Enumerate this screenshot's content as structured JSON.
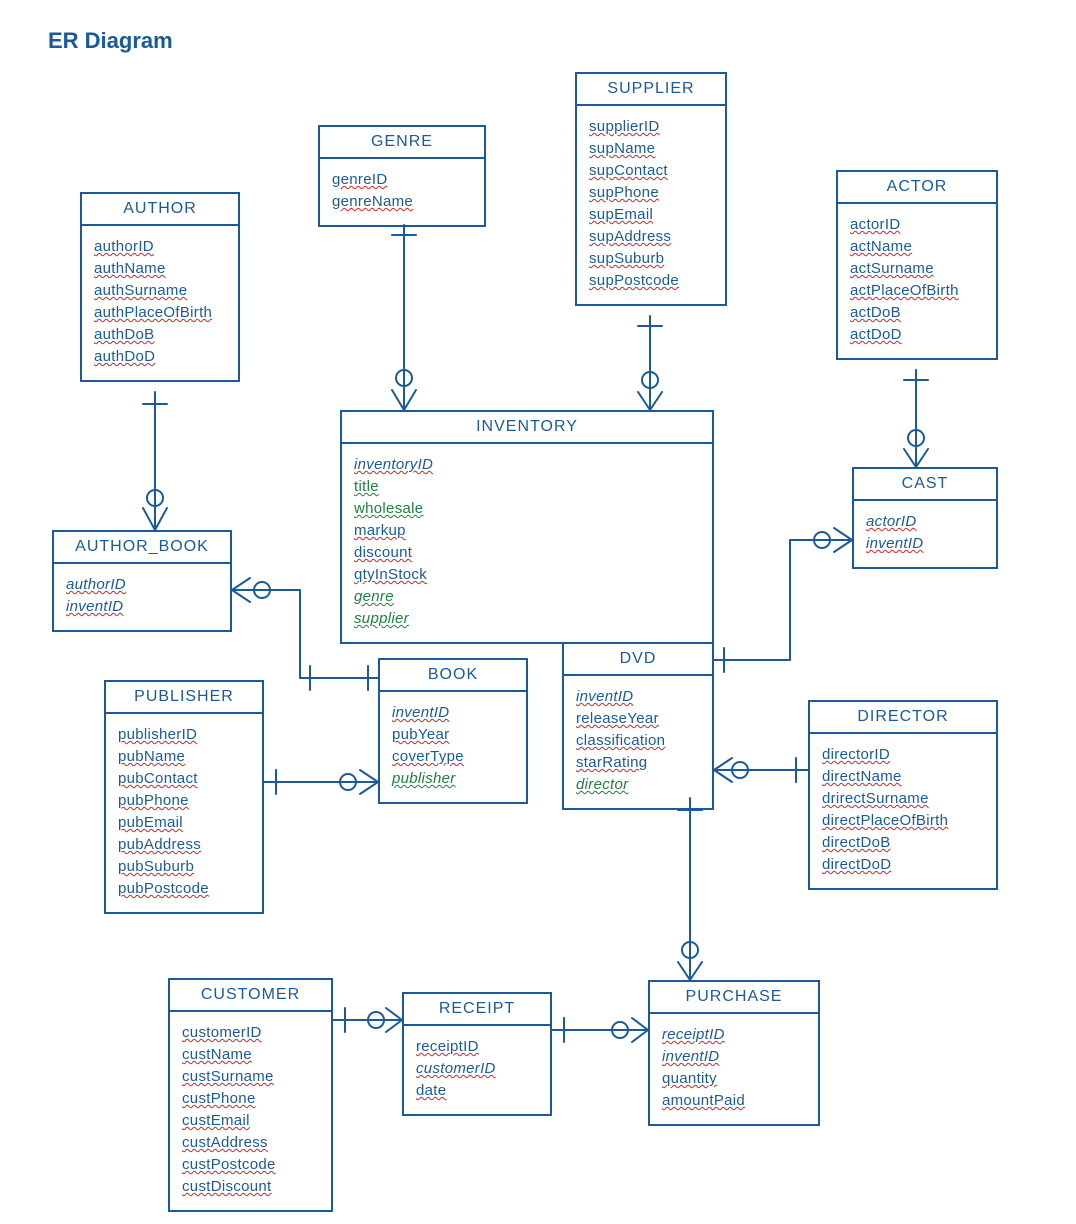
{
  "title": "ER Diagram",
  "entities": {
    "author": {
      "name": "AUTHOR",
      "attrs": [
        "authorID",
        "authName",
        "authSurname",
        "authPlaceOfBirth",
        "authDoB",
        "authDoD"
      ],
      "italics": [],
      "fks": []
    },
    "author_book": {
      "name": "AUTHOR_BOOK",
      "attrs": [
        "authorID",
        "inventID"
      ],
      "italics": [
        "authorID",
        "inventID"
      ],
      "fks": []
    },
    "genre": {
      "name": "GENRE",
      "attrs": [
        "genreID",
        "genreName"
      ],
      "italics": [],
      "fks": []
    },
    "supplier": {
      "name": "SUPPLIER",
      "attrs": [
        "supplierID",
        "supName",
        "supContact",
        "supPhone",
        "supEmail",
        "supAddress",
        "supSuburb",
        "supPostcode"
      ],
      "italics": [],
      "fks": []
    },
    "actor": {
      "name": "ACTOR",
      "attrs": [
        "actorID",
        "actName",
        "actSurname",
        "actPlaceOfBirth",
        "actDoB",
        "actDoD"
      ],
      "italics": [],
      "fks": []
    },
    "cast": {
      "name": "CAST",
      "attrs": [
        "actorID",
        "inventID"
      ],
      "italics": [
        "actorID",
        "inventID"
      ],
      "fks": []
    },
    "inventory": {
      "name": "INVENTORY",
      "attrs": [
        "inventoryID",
        "title",
        "wholesale",
        "markup",
        "discount",
        "qtyInStock",
        "genre",
        "supplier"
      ],
      "italics": [
        "inventoryID",
        "genre",
        "supplier"
      ],
      "fks": [
        "title",
        "genre",
        "supplier",
        "wholesale"
      ]
    },
    "book": {
      "name": "BOOK",
      "attrs": [
        "inventID",
        "pubYear",
        "coverType",
        "publisher"
      ],
      "italics": [
        "inventID",
        "publisher"
      ],
      "fks": [
        "publisher"
      ]
    },
    "dvd": {
      "name": "DVD",
      "attrs": [
        "inventID",
        "releaseYear",
        "classification",
        "starRating",
        "director"
      ],
      "italics": [
        "inventID",
        "director"
      ],
      "fks": [
        "director"
      ]
    },
    "publisher": {
      "name": "PUBLISHER",
      "attrs": [
        "publisherID",
        "pubName",
        "pubContact",
        "pubPhone",
        "pubEmail",
        "pubAddress",
        "pubSuburb",
        "pubPostcode"
      ],
      "italics": [],
      "fks": []
    },
    "director": {
      "name": "DIRECTOR",
      "attrs": [
        "directorID",
        "directName",
        "drirectSurname",
        "directPlaceOfBirth",
        "directDoB",
        "directDoD"
      ],
      "italics": [],
      "fks": []
    },
    "customer": {
      "name": "CUSTOMER",
      "attrs": [
        "customerID",
        "custName",
        "custSurname",
        "custPhone",
        "custEmail",
        "custAddress",
        "custPostcode",
        "custDiscount"
      ],
      "italics": [],
      "fks": []
    },
    "receipt": {
      "name": "RECEIPT",
      "attrs": [
        "receiptID",
        "customerID",
        "date"
      ],
      "italics": [
        "customerID"
      ],
      "fks": []
    },
    "purchase": {
      "name": "PURCHASE",
      "attrs": [
        "receiptID",
        "inventID",
        "quantity",
        "amountPaid"
      ],
      "italics": [
        "receiptID",
        "inventID"
      ],
      "fks": []
    }
  }
}
